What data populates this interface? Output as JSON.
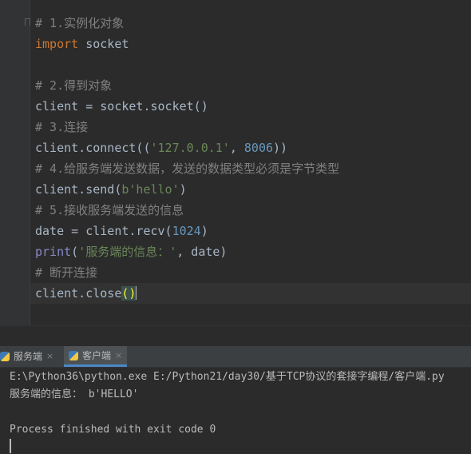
{
  "editor": {
    "lines": [
      {
        "parts": [
          {
            "text": "# 1.实例化对象",
            "kind": "comment"
          }
        ]
      },
      {
        "parts": [
          {
            "text": "import",
            "kind": "kw"
          },
          {
            "text": " socket",
            "kind": "plain"
          }
        ]
      },
      {
        "parts": []
      },
      {
        "parts": [
          {
            "text": "# 2.得到对象",
            "kind": "comment"
          }
        ]
      },
      {
        "parts": [
          {
            "text": "client = socket.socket()",
            "kind": "plain"
          }
        ]
      },
      {
        "parts": [
          {
            "text": "# 3.连接",
            "kind": "comment"
          }
        ]
      },
      {
        "parts": [
          {
            "text": "client.connect((",
            "kind": "plain"
          },
          {
            "text": "'127.0.0.1'",
            "kind": "str"
          },
          {
            "text": ", ",
            "kind": "plain"
          },
          {
            "text": "8006",
            "kind": "num"
          },
          {
            "text": "))",
            "kind": "plain"
          }
        ]
      },
      {
        "parts": [
          {
            "text": "# 4.给服务端发送数据，发送的数据类型必须是字节类型",
            "kind": "comment"
          }
        ]
      },
      {
        "parts": [
          {
            "text": "client.send(",
            "kind": "plain"
          },
          {
            "text": "b'hello'",
            "kind": "str"
          },
          {
            "text": ")",
            "kind": "plain"
          }
        ]
      },
      {
        "parts": [
          {
            "text": "# 5.接收服务端发送的信息",
            "kind": "comment"
          }
        ]
      },
      {
        "parts": [
          {
            "text": "date = client.recv(",
            "kind": "plain"
          },
          {
            "text": "1024",
            "kind": "num"
          },
          {
            "text": ")",
            "kind": "plain"
          }
        ]
      },
      {
        "parts": [
          {
            "text": "print",
            "kind": "builtin"
          },
          {
            "text": "(",
            "kind": "plain"
          },
          {
            "text": "'服务端的信息：'",
            "kind": "str"
          },
          {
            "text": ", date)",
            "kind": "plain"
          }
        ]
      },
      {
        "parts": [
          {
            "text": "# 断开连接",
            "kind": "comment"
          }
        ]
      },
      {
        "parts": [
          {
            "text": "client.close",
            "kind": "plain"
          },
          {
            "text": "()",
            "kind": "paren-hl"
          }
        ]
      }
    ]
  },
  "run_panel": {
    "tabs": [
      {
        "label": "服务端",
        "active": false,
        "close": "×"
      },
      {
        "label": "客户端",
        "active": true,
        "close": "×"
      }
    ]
  },
  "console": {
    "lines": [
      "E:\\Python36\\python.exe E:/Python21/day30/基于TCP协议的套接字编程/客户端.py",
      "服务端的信息： b'HELLO'",
      "",
      "Process finished with exit code 0"
    ]
  },
  "colors": {
    "editor_bg": "#2b2b2b",
    "keyword": "#cc7832",
    "string": "#6a8759",
    "number": "#6897bb",
    "comment": "#808080",
    "builtin": "#8888c6",
    "text": "#a9b7c6"
  },
  "icons": {
    "tab_icon": "python-icon",
    "close": "close-icon"
  }
}
